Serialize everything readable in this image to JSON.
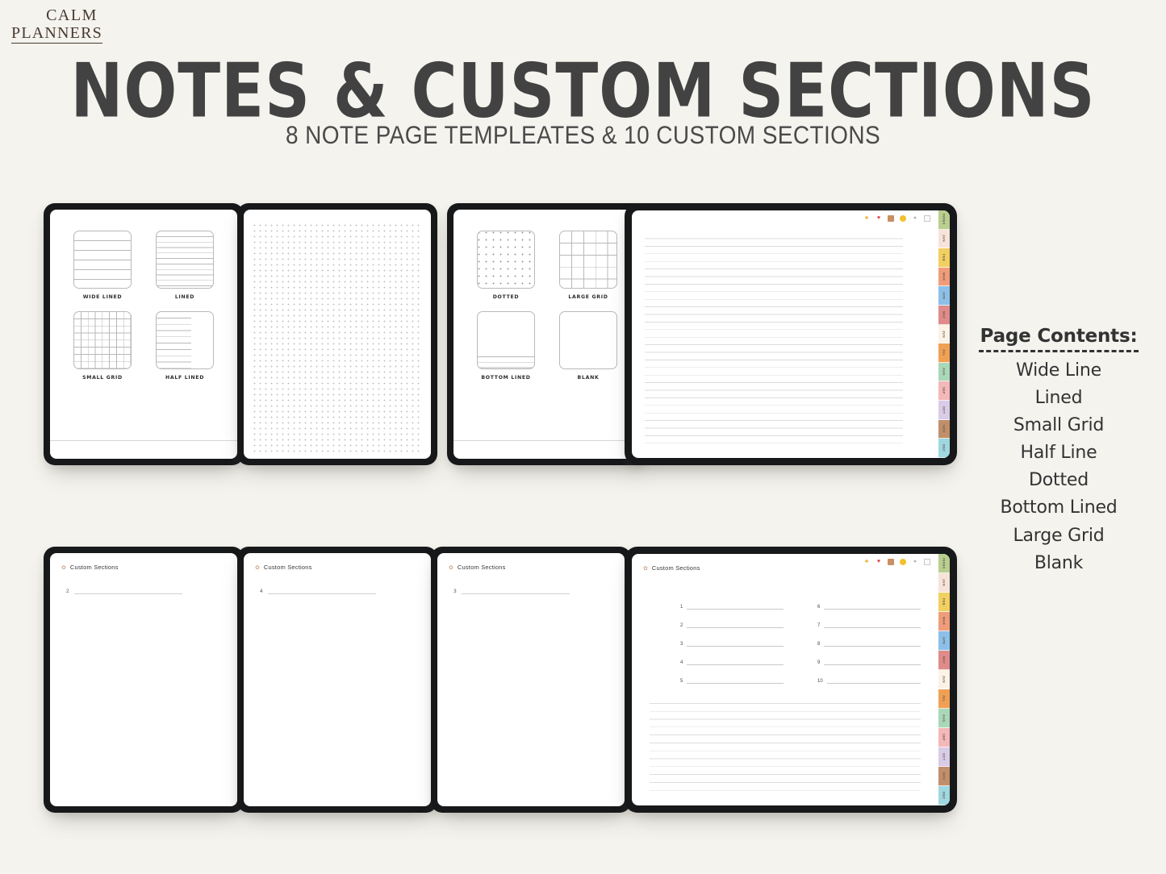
{
  "brand": {
    "line1": "CALM",
    "line2": "PLANNERS"
  },
  "header": {
    "title": "NOTES & CUSTOM SECTIONS",
    "subtitle": "8 NOTE PAGE TEMPLEATES & 10 CUSTOM SECTIONS"
  },
  "page_contents": {
    "title": "Page Contents:",
    "items": [
      "Wide Line",
      "Lined",
      "Small Grid",
      "Half Line",
      "Dotted",
      "Bottom Lined",
      "Large Grid",
      "Blank"
    ]
  },
  "templates_page_1": [
    {
      "label": "WIDE LINED",
      "pattern": "wide"
    },
    {
      "label": "LINED",
      "pattern": "lined"
    },
    {
      "label": "SMALL GRID",
      "pattern": "smallgrid"
    },
    {
      "label": "HALF LINED",
      "pattern": "half"
    }
  ],
  "templates_page_2": [
    {
      "label": "DOTTED",
      "pattern": "dotted"
    },
    {
      "label": "LARGE GRID",
      "pattern": "largegrid"
    },
    {
      "label": "BOTTOM LINED",
      "pattern": "bottom"
    },
    {
      "label": "BLANK",
      "pattern": "blank"
    }
  ],
  "toolbar": {
    "icons": [
      "plant-icon",
      "heart-icon",
      "gift-icon",
      "circle-icon",
      "person-icon",
      "document-icon"
    ],
    "glyphs": [
      "ἳB",
      "♥",
      "■",
      "●",
      "▲",
      "▭"
    ]
  },
  "month_tabs": [
    {
      "label": "INDEX",
      "color": "#b9cf8f"
    },
    {
      "label": "JAN",
      "color": "#f7e3da"
    },
    {
      "label": "FEB",
      "color": "#f0d060"
    },
    {
      "label": "MAR",
      "color": "#f09c7a"
    },
    {
      "label": "APR",
      "color": "#8cc0e8"
    },
    {
      "label": "MAY",
      "color": "#e08a8a"
    },
    {
      "label": "JUN",
      "color": "#faf3e6"
    },
    {
      "label": "JUL",
      "color": "#f0a055"
    },
    {
      "label": "AUG",
      "color": "#a9d8b8"
    },
    {
      "label": "SEP",
      "color": "#f4b8b8"
    },
    {
      "label": "OCT",
      "color": "#d8cce8"
    },
    {
      "label": "NOV",
      "color": "#c08f6a"
    },
    {
      "label": "DEC",
      "color": "#9fd8e0"
    }
  ],
  "custom_sections": {
    "header_label": "Custom Sections",
    "header_icon": "flower-icon",
    "page_numbers": [
      "2",
      "4",
      "3"
    ],
    "list_numbers": [
      "1",
      "2",
      "3",
      "4",
      "5",
      "6",
      "7",
      "8",
      "9",
      "10"
    ]
  },
  "colors": {
    "background": "#f4f3ee",
    "bezel": "#17181a",
    "screen": "#ffffff",
    "brand_text": "#4a3a2e",
    "heading_text": "#424242"
  }
}
